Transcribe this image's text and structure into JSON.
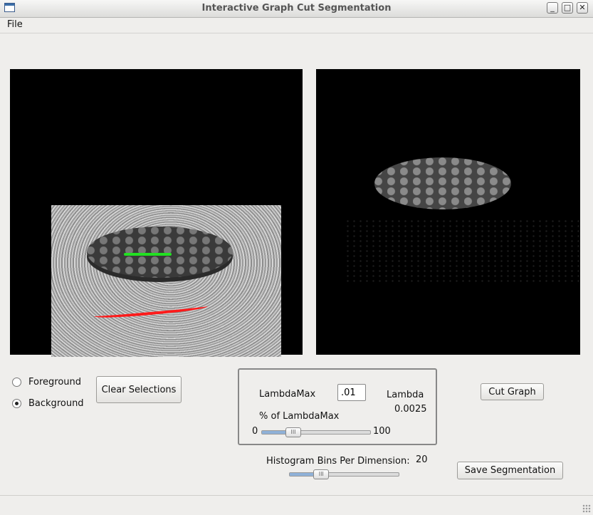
{
  "window": {
    "title": "Interactive Graph Cut Segmentation"
  },
  "menubar": {
    "items": [
      "File"
    ]
  },
  "controls": {
    "foreground_label": "Foreground",
    "background_label": "Background",
    "selected_mode": "Background",
    "clear_label": "Clear Selections",
    "cut_label": "Cut Graph",
    "save_label": "Save Segmentation"
  },
  "lambda_group": {
    "lambda_max_label": "LambdaMax",
    "lambda_max_value": ".01",
    "lambda_label": "Lambda",
    "lambda_value": "0.0025",
    "percent_label": "% of LambdaMax",
    "slider_min": "0",
    "slider_max": "100",
    "slider_percent": 25
  },
  "histogram": {
    "label": "Histogram Bins Per Dimension:",
    "value": "20",
    "slider_fraction": 0.25
  },
  "colors": {
    "foreground_stroke": "#22e022",
    "background_stroke": "#ff1a1a",
    "slider_fill": "#8fb1d8"
  }
}
